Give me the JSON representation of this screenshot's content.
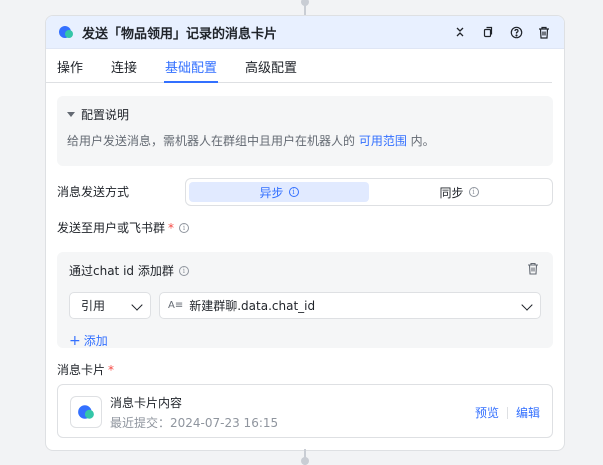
{
  "header": {
    "title": "发送「物品领用」记录的消息卡片"
  },
  "tabs": [
    {
      "label": "操作"
    },
    {
      "label": "连接"
    },
    {
      "label": "基础配置"
    },
    {
      "label": "高级配置"
    }
  ],
  "active_tab": "基础配置",
  "config_info": {
    "title": "配置说明",
    "text_before": "给用户发送消息，需机器人在群组中且用户在机器人的 ",
    "link": "可用范围",
    "text_after": " 内。"
  },
  "send_mode": {
    "label": "消息发送方式",
    "options": [
      "异步",
      "同步"
    ],
    "selected": "异步"
  },
  "recipient": {
    "label": "发送至用户或飞书群",
    "required_mark": "*",
    "group_title": "通过chat id 添加群",
    "select_type": "引用",
    "select_value": "新建群聊.data.chat_id",
    "add_label": "添加"
  },
  "message_card": {
    "label": "消息卡片",
    "required_mark": "*",
    "name": "消息卡片内容",
    "meta": "最近提交：2024-07-23 16:15",
    "preview_label": "预览",
    "edit_label": "编辑"
  },
  "colors": {
    "accent": "#3370ff",
    "header_bg": "#e8f0ff",
    "required": "#f54a45"
  }
}
